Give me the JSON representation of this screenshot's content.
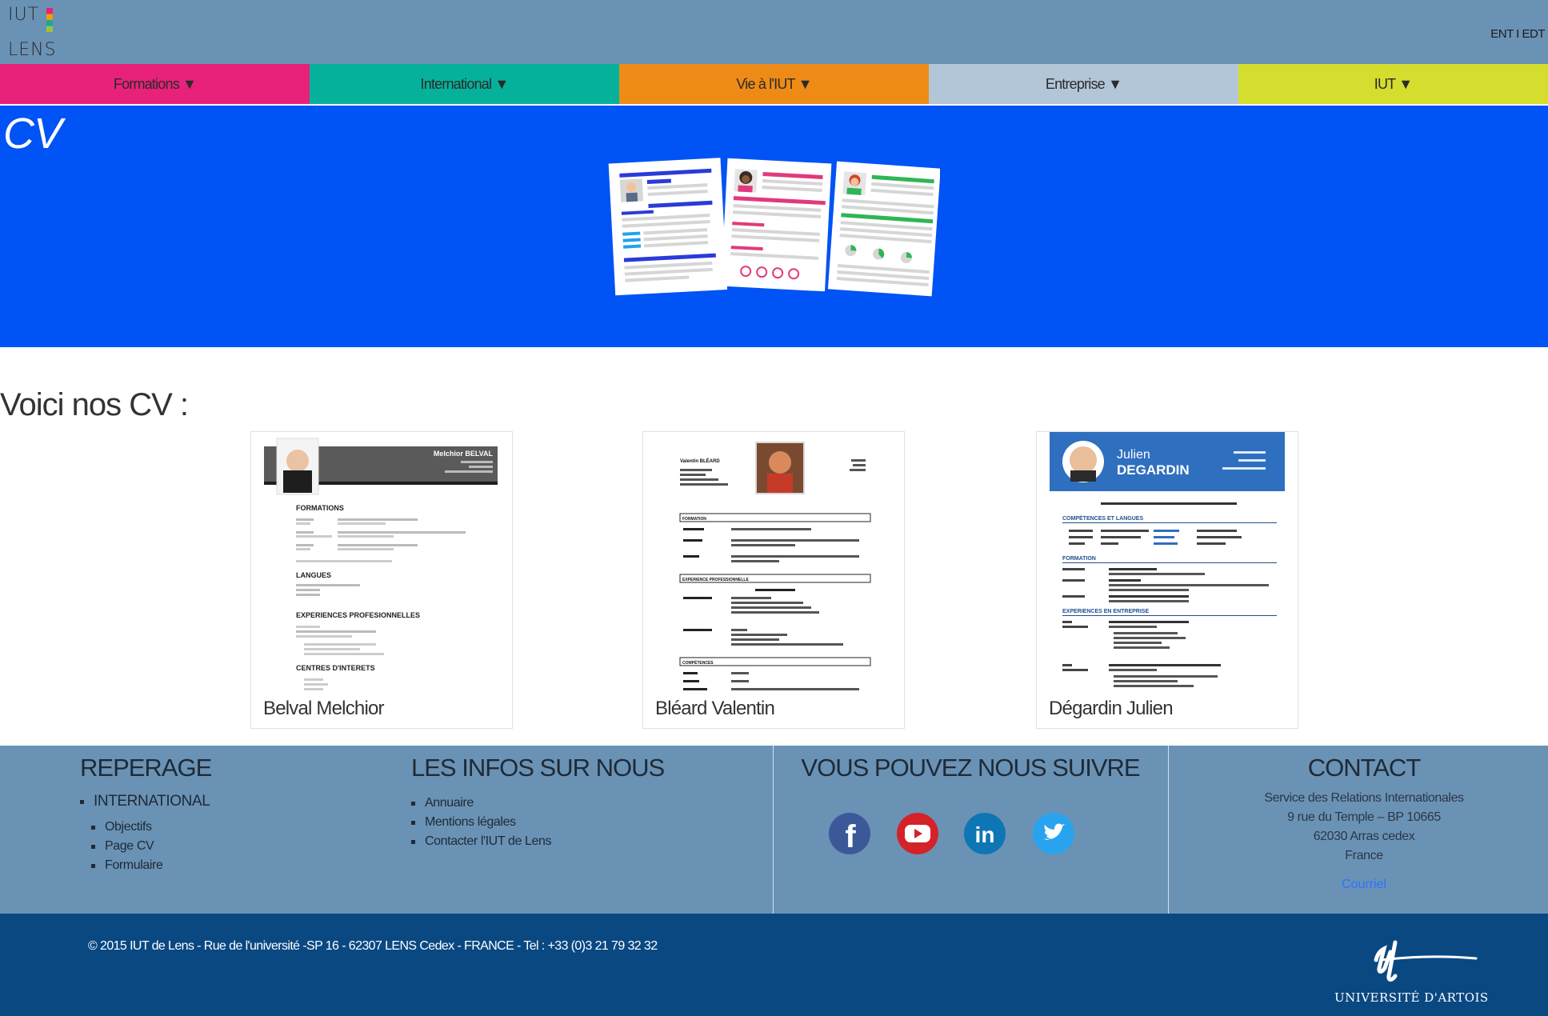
{
  "header": {
    "logo_line1": "IUT",
    "logo_line2": "LENS",
    "top_links": "ENT I EDT"
  },
  "nav": {
    "items": [
      {
        "label": "Formations ▼",
        "color": "#e8217a"
      },
      {
        "label": "International ▼",
        "color": "#06b19c"
      },
      {
        "label": "Vie à l'IUT ▼",
        "color": "#ee8b17"
      },
      {
        "label": "Entreprise ▼",
        "color": "#b3c6d8"
      },
      {
        "label": "IUT ▼",
        "color": "#d5dd2e"
      }
    ]
  },
  "hero": {
    "title": "CV",
    "background": "#0053f5"
  },
  "main": {
    "section_title": "Voici nos CV :",
    "cards": [
      {
        "name": "Belval Melchior",
        "thumb": {
          "header_name": "Melchior BELVAL",
          "sections": [
            "FORMATIONS",
            "LANGUES",
            "EXPERIENCES PROFESIONNELLES",
            "CENTRES D'INTERETS"
          ]
        }
      },
      {
        "name": "Bléard Valentin",
        "thumb": {
          "header_name": "Valentin BLÉARD",
          "sections": [
            "FORMATION",
            "EXPERIENCE PROFESSIONNELLE",
            "COMPÉTENCES"
          ]
        }
      },
      {
        "name": "Dégardin Julien",
        "thumb": {
          "first_name": "Julien",
          "last_name": "DEGARDIN",
          "sections": [
            "COMPÉTENCES ET LANGUES",
            "FORMATION",
            "EXPERIENCES EN ENTREPRISE"
          ]
        }
      }
    ]
  },
  "footer": {
    "reperage": {
      "title": "REPERAGE",
      "top_item": "INTERNATIONAL",
      "sub_items": [
        "Objectifs",
        "Page CV",
        "Formulaire"
      ]
    },
    "infos": {
      "title": "LES INFOS SUR NOUS",
      "items": [
        "Annuaire",
        "Mentions légales",
        "Contacter l'IUT de Lens"
      ]
    },
    "social": {
      "title": "VOUS POUVEZ NOUS SUIVRE",
      "icons": [
        "facebook-icon",
        "youtube-icon",
        "linkedin-icon",
        "twitter-icon"
      ]
    },
    "contact": {
      "title": "CONTACT",
      "lines": [
        "Service des Relations Internationales",
        "9 rue du Temple – BP 10665",
        "62030 Arras cedex",
        "France"
      ],
      "link": "Courriel"
    }
  },
  "bottom": {
    "copyright": "© 2015 IUT de Lens - Rue de l'université -SP 16 - 62307 LENS Cedex - FRANCE - Tel : +33 (0)3 21 79 32 32",
    "university": "UNIVERSITÉ D'ARTOIS"
  }
}
